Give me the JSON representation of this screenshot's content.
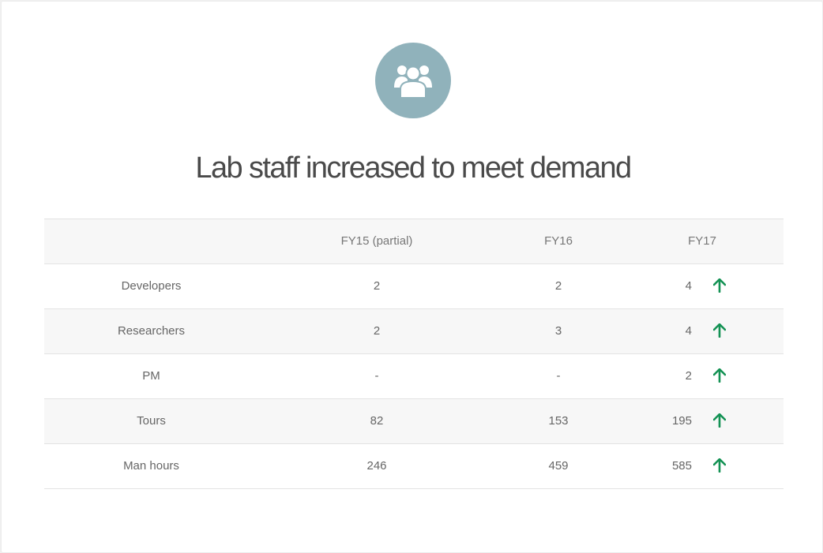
{
  "icon": "group-users-icon",
  "title": "Lab staff increased to meet demand",
  "colors": {
    "icon_circle": "#90b2bb",
    "arrow": "#149254",
    "row_shade": "#f7f7f7"
  },
  "table": {
    "headers": [
      "",
      "FY15 (partial)",
      "FY16",
      "FY17"
    ],
    "rows": [
      {
        "label": "Developers",
        "fy15": "2",
        "fy16": "2",
        "fy17": "4",
        "trend": "up-arrow-icon"
      },
      {
        "label": "Researchers",
        "fy15": "2",
        "fy16": "3",
        "fy17": "4",
        "trend": "up-arrow-icon"
      },
      {
        "label": "PM",
        "fy15": "-",
        "fy16": "-",
        "fy17": "2",
        "trend": "up-arrow-icon"
      },
      {
        "label": "Tours",
        "fy15": "82",
        "fy16": "153",
        "fy17": "195",
        "trend": "up-arrow-icon"
      },
      {
        "label": "Man hours",
        "fy15": "246",
        "fy16": "459",
        "fy17": "585",
        "trend": "up-arrow-icon"
      }
    ]
  }
}
